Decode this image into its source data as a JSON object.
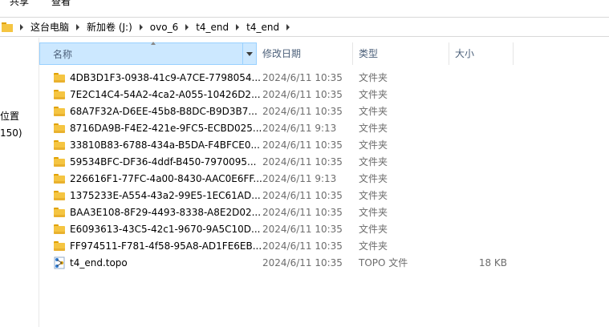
{
  "ribbon": {
    "share": "共享",
    "view": "查看"
  },
  "address": {
    "crumbs": [
      "这台电脑",
      "新加卷 (J:)",
      "ovo_6",
      "t4_end",
      "t4_end"
    ]
  },
  "left_pane": {
    "line1": "位置",
    "line2": "150)"
  },
  "columns": {
    "name": "名称",
    "date": "修改日期",
    "type": "类型",
    "size": "大小"
  },
  "files": [
    {
      "name": "4DB3D1F3-0938-41c9-A7CE-7798054...",
      "date": "2024/6/11 10:35",
      "type": "文件夹",
      "size": "",
      "icon": "folder-icon"
    },
    {
      "name": "7E2C14C4-54A2-4ca2-A055-10426D2...",
      "date": "2024/6/11 10:35",
      "type": "文件夹",
      "size": "",
      "icon": "folder-icon"
    },
    {
      "name": "68A7F32A-D6EE-45b8-B8DC-B9D3B7...",
      "date": "2024/6/11 10:35",
      "type": "文件夹",
      "size": "",
      "icon": "folder-icon"
    },
    {
      "name": "8716DA9B-F4E2-421e-9FC5-ECBD025...",
      "date": "2024/6/11 9:13",
      "type": "文件夹",
      "size": "",
      "icon": "folder-icon"
    },
    {
      "name": "33810B83-6788-434a-B5DA-F4BFCE0...",
      "date": "2024/6/11 10:35",
      "type": "文件夹",
      "size": "",
      "icon": "folder-icon"
    },
    {
      "name": "59534BFC-DF36-4ddf-B450-7970095...",
      "date": "2024/6/11 10:35",
      "type": "文件夹",
      "size": "",
      "icon": "folder-icon"
    },
    {
      "name": "226616F1-77FC-4a00-8430-AAC0E6FF...",
      "date": "2024/6/11 9:13",
      "type": "文件夹",
      "size": "",
      "icon": "folder-icon"
    },
    {
      "name": "1375233E-A554-43a2-99E5-1EC61AD...",
      "date": "2024/6/11 10:35",
      "type": "文件夹",
      "size": "",
      "icon": "folder-icon"
    },
    {
      "name": "BAA3E108-8F29-4493-8338-A8E2D02...",
      "date": "2024/6/11 10:35",
      "type": "文件夹",
      "size": "",
      "icon": "folder-icon"
    },
    {
      "name": "E6093613-43C5-42c1-9670-9A5C10D...",
      "date": "2024/6/11 10:35",
      "type": "文件夹",
      "size": "",
      "icon": "folder-icon"
    },
    {
      "name": "FF974511-F781-4f58-95A8-AD1FE6EB...",
      "date": "2024/6/11 10:35",
      "type": "文件夹",
      "size": "",
      "icon": "folder-icon"
    },
    {
      "name": "t4_end.topo",
      "date": "2024/6/11 10:35",
      "type": "TOPO 文件",
      "size": "18 KB",
      "icon": "topo-file-icon"
    }
  ]
}
